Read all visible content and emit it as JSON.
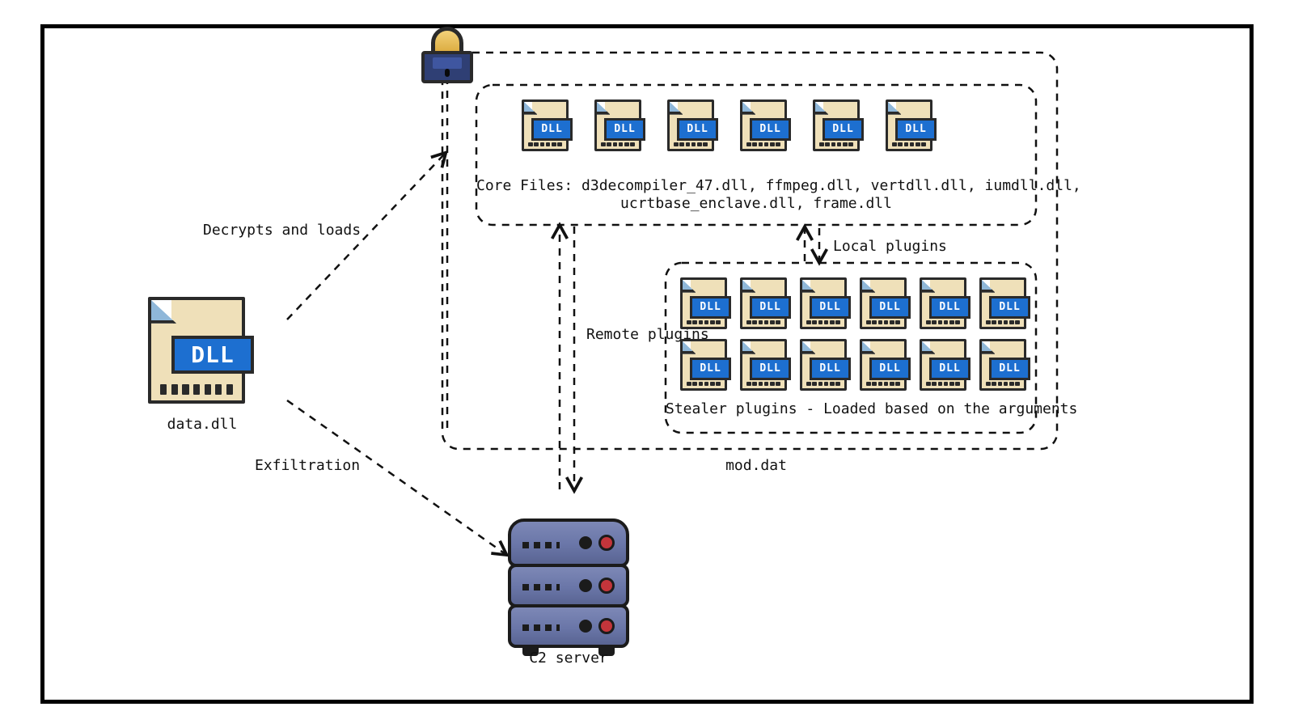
{
  "icons": {
    "dll_badge": "DLL"
  },
  "data_dll": {
    "label": "data.dll"
  },
  "c2_server": {
    "label": "C2 server"
  },
  "mod_dat": {
    "label": "mod.dat"
  },
  "edges": {
    "decrypt": "Decrypts and loads",
    "exfiltration": "Exfiltration",
    "remote_plugins": "Remote plugins",
    "local_plugins": "Local plugins"
  },
  "core_files": {
    "count": 6,
    "caption_line1": "Core Files: d3decompiler_47.dll, ffmpeg.dll, vertdll.dll, iumdll.dll,",
    "caption_line2": "ucrtbase_enclave.dll, frame.dll"
  },
  "stealer_plugins": {
    "row1_count": 6,
    "row2_count": 6,
    "caption": "Stealer plugins - Loaded based on the arguments"
  }
}
